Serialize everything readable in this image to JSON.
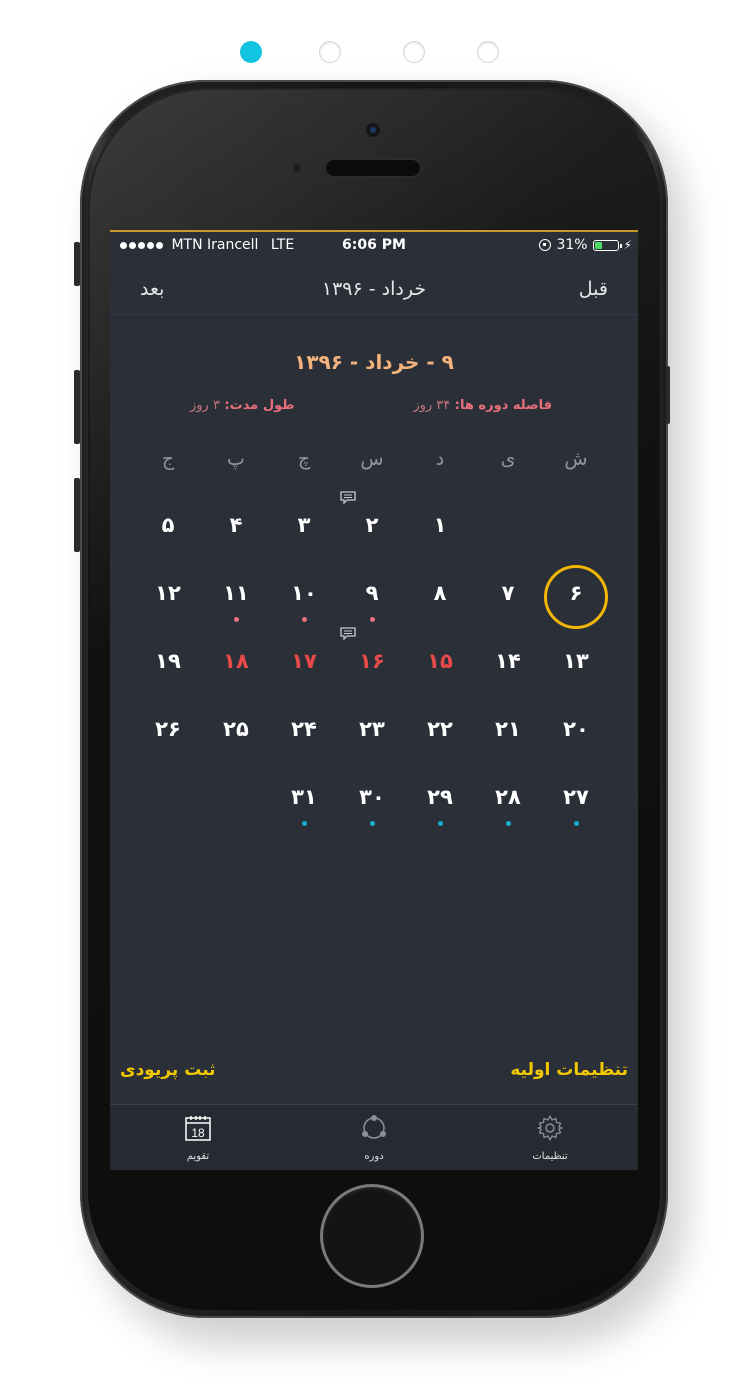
{
  "pager": {
    "count": 4,
    "active_index": 0
  },
  "status_bar": {
    "carrier": "MTN Irancell",
    "network": "LTE",
    "time": "6:06 PM",
    "battery": "31%",
    "battery_level": 0.31,
    "battery_color": "#4cd964"
  },
  "nav": {
    "next_label": "بعد",
    "title": "خرداد - ۱۳۹۶",
    "prev_label": "قبل"
  },
  "selected_date": "۹ - خرداد - ۱۳۹۶",
  "info": {
    "cycle_label": "فاصله دوره ها:",
    "cycle_value": "۳۴ روز",
    "duration_label": "طول مدت:",
    "duration_value": "۳ روز"
  },
  "weekdays": [
    "ش",
    "ی",
    "د",
    "س",
    "چ",
    "پ",
    "ج"
  ],
  "calendar": {
    "weeks": [
      [
        null,
        null,
        {
          "n": "۱"
        },
        {
          "n": "۲",
          "note": true
        },
        {
          "n": "۳"
        },
        {
          "n": "۴"
        },
        {
          "n": "۵"
        }
      ],
      [
        {
          "n": "۶",
          "today": true
        },
        {
          "n": "۷"
        },
        {
          "n": "۸"
        },
        {
          "n": "۹",
          "dot": "red"
        },
        {
          "n": "۱۰",
          "dot": "red"
        },
        {
          "n": "۱۱",
          "dot": "red"
        },
        {
          "n": "۱۲"
        }
      ],
      [
        {
          "n": "۱۳"
        },
        {
          "n": "۱۴"
        },
        {
          "n": "۱۵",
          "holiday": true
        },
        {
          "n": "۱۶",
          "holiday": true,
          "note": true
        },
        {
          "n": "۱۷",
          "holiday": true
        },
        {
          "n": "۱۸",
          "holiday": true
        },
        {
          "n": "۱۹"
        }
      ],
      [
        {
          "n": "۲۰"
        },
        {
          "n": "۲۱"
        },
        {
          "n": "۲۲"
        },
        {
          "n": "۲۳"
        },
        {
          "n": "۲۴"
        },
        {
          "n": "۲۵"
        },
        {
          "n": "۲۶"
        }
      ],
      [
        {
          "n": "۲۷",
          "dot": "teal"
        },
        {
          "n": "۲۸",
          "dot": "teal"
        },
        {
          "n": "۲۹",
          "dot": "teal"
        },
        {
          "n": "۳۰",
          "dot": "teal"
        },
        {
          "n": "۳۱",
          "dot": "teal"
        },
        null,
        null
      ]
    ]
  },
  "actions": {
    "settings_label": "تنظیمات اولیه",
    "register_label": "ثبت پریودی"
  },
  "tabs": [
    {
      "label": "تقویم",
      "icon": "calendar-icon",
      "calendar_number": "18"
    },
    {
      "label": "دوره",
      "icon": "cycle-icon"
    },
    {
      "label": "تنظیمات",
      "icon": "gear-icon"
    }
  ],
  "colors": {
    "accent_today": "#f2b705",
    "holiday": "#e84a4a",
    "period_dot": "#e8707c",
    "fertile_dot": "#19b1cf",
    "action_text": "#f2c800",
    "selected_date": "#f4b27c",
    "pager_active": "#13c4e0"
  }
}
